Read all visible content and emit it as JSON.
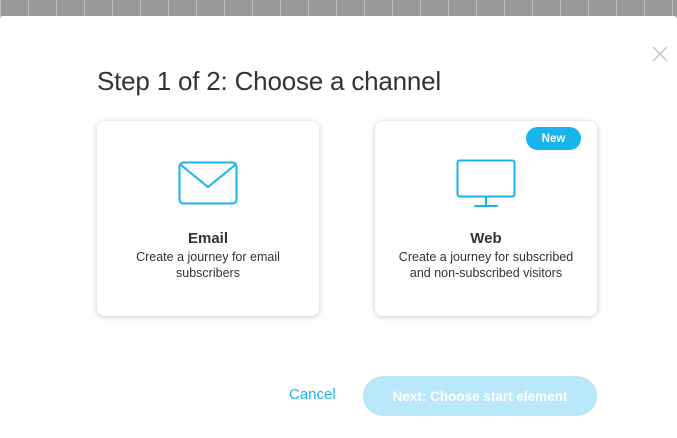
{
  "dialog": {
    "title": "Step 1 of 2: Choose a channel",
    "close_icon": "close-icon"
  },
  "channels": [
    {
      "icon": "envelope-icon",
      "title": "Email",
      "description": "Create a journey for email subscribers"
    },
    {
      "icon": "monitor-icon",
      "title": "Web",
      "description": "Create a journey for subscribed and non-subscribed visitors",
      "badge": "New"
    }
  ],
  "footer": {
    "cancel_label": "Cancel",
    "next_label": "Next: Choose start element"
  },
  "colors": {
    "accent": "#18b4ee",
    "disabled_button": "#b9e8fb",
    "text": "#333333",
    "backdrop": "#9a9a9a"
  }
}
